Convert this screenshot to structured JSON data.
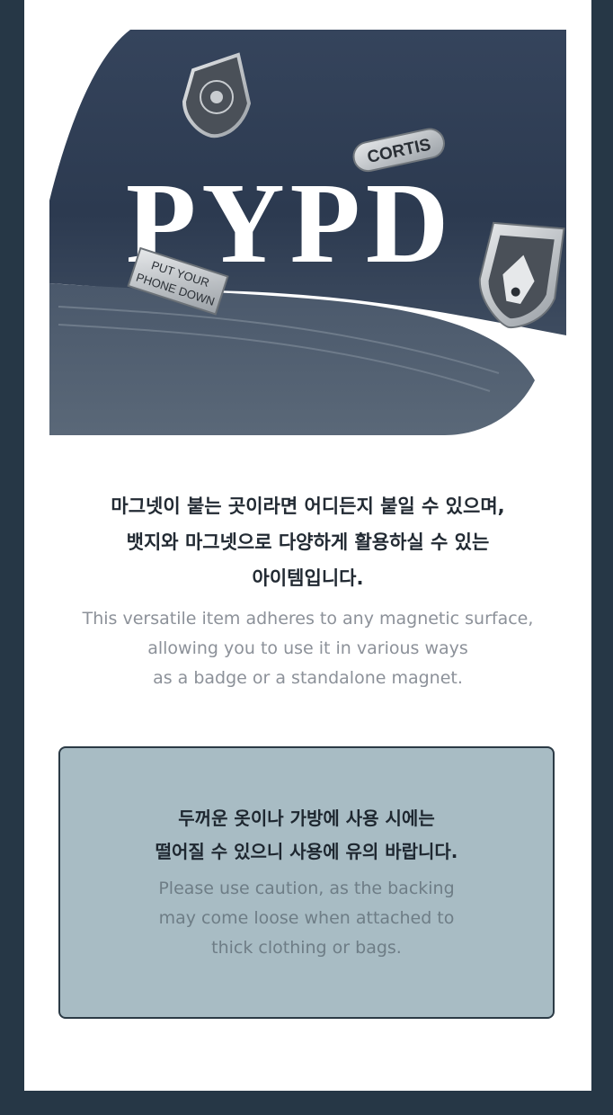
{
  "photo": {
    "cap_text": "PYPD",
    "pin_cortis": "CORTIS",
    "pin_bar_line1": "PUT YOUR",
    "pin_bar_line2": "PHONE DOWN",
    "pin_shield_text": "PUT YOUR PHONE DOWN",
    "colors": {
      "cap": "#2c3a50",
      "embroidery": "#ffffff",
      "pin_metal": "#c8ccd0"
    }
  },
  "intro": {
    "korean": "마그넷이 붙는 곳이라면 어디든지 붙일 수 있으며,\n뱃지와 마그넷으로 다양하게 활용하실 수 있는\n아이템입니다.",
    "english": "This versatile item adheres to any magnetic surface,\nallowing you to use it in various ways\nas a badge or a standalone magnet."
  },
  "notice": {
    "korean": "두꺼운 옷이나 가방에 사용 시에는\n떨어질 수 있으니 사용에 유의 바랍니다.",
    "english": "Please use caution, as the backing\nmay come loose when attached to\nthick clothing or bags.",
    "background_color": "#a8bcc4"
  }
}
